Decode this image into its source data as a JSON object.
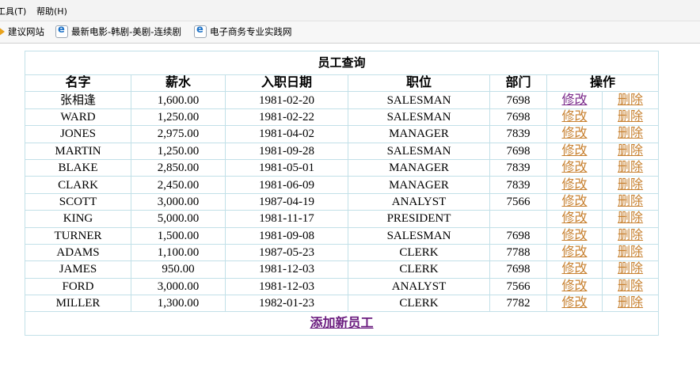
{
  "browser": {
    "menu": [
      "工具(T)",
      "帮助(H)"
    ],
    "favorites": [
      "建议网站",
      "最新电影-韩剧-美剧-连续剧",
      "电子商务专业实践网"
    ]
  },
  "table": {
    "title": "员工查询",
    "headers": [
      "名字",
      "薪水",
      "入职日期",
      "职位",
      "部门",
      "操作"
    ],
    "edit_label": "修改",
    "delete_label": "删除",
    "rows": [
      {
        "name": "张相逢",
        "salary": "1,600.00",
        "hiredate": "1981-02-20",
        "job": "SALESMAN",
        "dept": "7698"
      },
      {
        "name": "WARD",
        "salary": "1,250.00",
        "hiredate": "1981-02-22",
        "job": "SALESMAN",
        "dept": "7698"
      },
      {
        "name": "JONES",
        "salary": "2,975.00",
        "hiredate": "1981-04-02",
        "job": "MANAGER",
        "dept": "7839"
      },
      {
        "name": "MARTIN",
        "salary": "1,250.00",
        "hiredate": "1981-09-28",
        "job": "SALESMAN",
        "dept": "7698"
      },
      {
        "name": "BLAKE",
        "salary": "2,850.00",
        "hiredate": "1981-05-01",
        "job": "MANAGER",
        "dept": "7839"
      },
      {
        "name": "CLARK",
        "salary": "2,450.00",
        "hiredate": "1981-06-09",
        "job": "MANAGER",
        "dept": "7839"
      },
      {
        "name": "SCOTT",
        "salary": "3,000.00",
        "hiredate": "1987-04-19",
        "job": "ANALYST",
        "dept": "7566"
      },
      {
        "name": "KING",
        "salary": "5,000.00",
        "hiredate": "1981-11-17",
        "job": "PRESIDENT",
        "dept": ""
      },
      {
        "name": "TURNER",
        "salary": "1,500.00",
        "hiredate": "1981-09-08",
        "job": "SALESMAN",
        "dept": "7698"
      },
      {
        "name": "ADAMS",
        "salary": "1,100.00",
        "hiredate": "1987-05-23",
        "job": "CLERK",
        "dept": "7788"
      },
      {
        "name": "JAMES",
        "salary": "950.00",
        "hiredate": "1981-12-03",
        "job": "CLERK",
        "dept": "7698"
      },
      {
        "name": "FORD",
        "salary": "3,000.00",
        "hiredate": "1981-12-03",
        "job": "ANALYST",
        "dept": "7566"
      },
      {
        "name": "MILLER",
        "salary": "1,300.00",
        "hiredate": "1982-01-23",
        "job": "CLERK",
        "dept": "7782"
      }
    ],
    "add_label": "添加新员工"
  },
  "colors": {
    "border": "#c2e0e8",
    "link_op": "#c7802f",
    "link_add": "#6a1b7e",
    "edit_first_visited": "#7a2a8a"
  }
}
